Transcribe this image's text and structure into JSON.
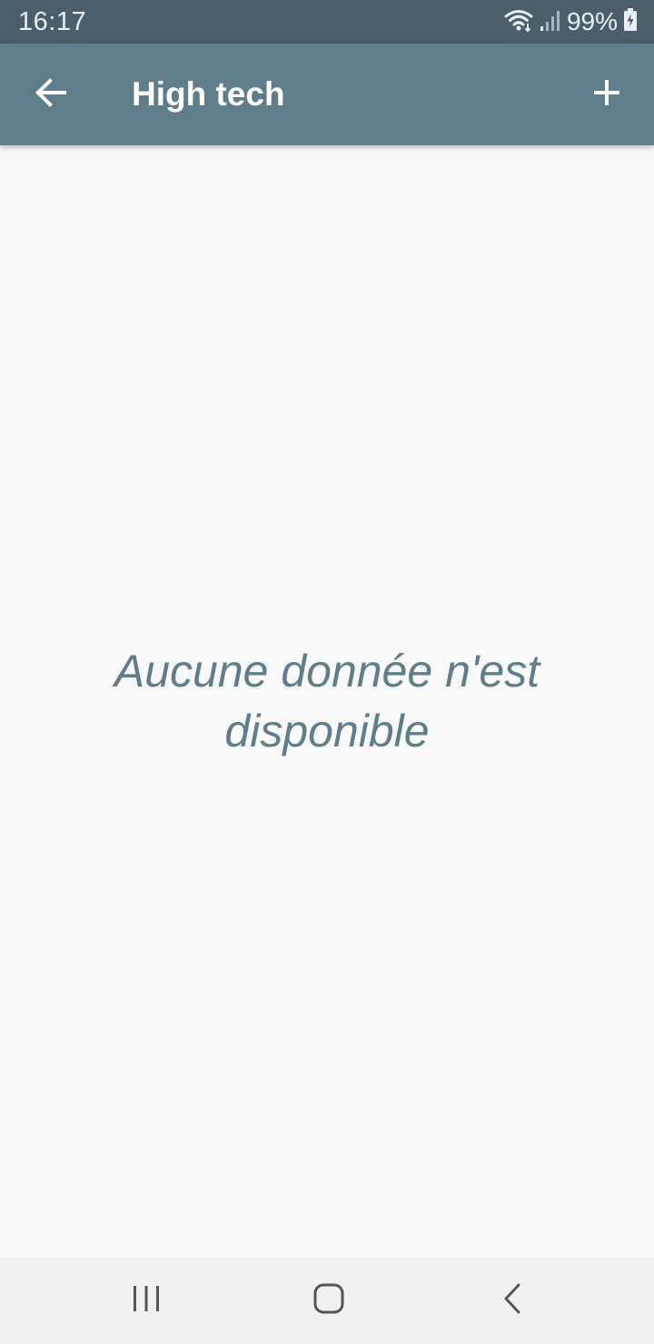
{
  "status_bar": {
    "time": "16:17",
    "battery_percent": "99%",
    "icons": [
      "wifi-icon",
      "signal-icon",
      "battery-charging-icon"
    ]
  },
  "app_bar": {
    "title": "High tech",
    "back_icon": "arrow-back-icon",
    "add_icon": "plus-icon",
    "color": "#607d8b"
  },
  "main": {
    "empty_message": "Aucune donnée n'est disponible"
  },
  "nav_bar": {
    "buttons": [
      "recents-icon",
      "home-icon",
      "back-icon"
    ]
  },
  "colors": {
    "status_bar": "#4a5f6b",
    "app_bar": "#607d8b",
    "background": "#f9f9f9",
    "empty_text": "#607d8b"
  }
}
